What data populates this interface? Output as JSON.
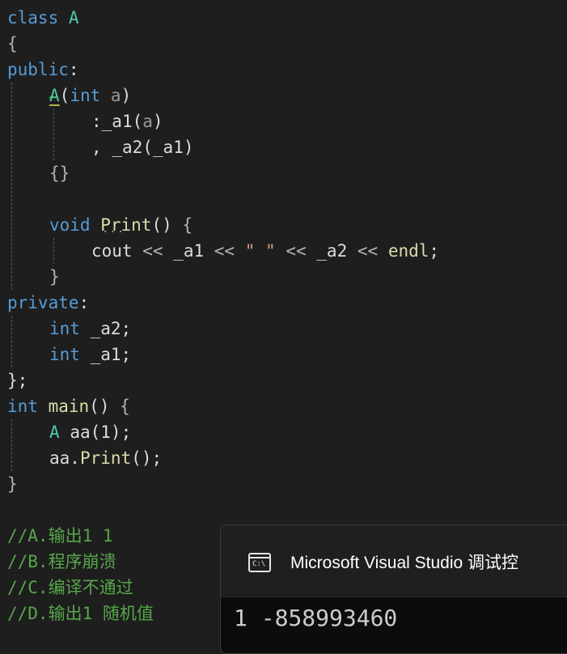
{
  "code": {
    "l1": {
      "kw": "class",
      "name": "A"
    },
    "l2": {
      "brace": "{"
    },
    "l3": {
      "kw": "public",
      "colon": ":"
    },
    "l4": {
      "ctor": "A",
      "lp": "(",
      "ty": "int",
      "param": "a",
      "rp": ")"
    },
    "l5": {
      "colon": ":",
      "m": "_a1",
      "lp": "(",
      "arg": "a",
      "rp": ")"
    },
    "l6": {
      "comma": ",",
      "m": "_a2",
      "lp": "(",
      "arg": "_a1",
      "rp": ")"
    },
    "l7": {
      "braces": "{}"
    },
    "l9": {
      "ty": "void",
      "fn": "Print",
      "parens": "()",
      "brace": "{"
    },
    "l10": {
      "cout": "cout",
      "op1": "<<",
      "a1": "_a1",
      "op2": "<<",
      "str": "\" \"",
      "op3": "<<",
      "a2": "_a2",
      "op4": "<<",
      "endl": "endl",
      "semi": ";"
    },
    "l11": {
      "brace": "}"
    },
    "l12": {
      "kw": "private",
      "colon": ":"
    },
    "l13": {
      "ty": "int",
      "name": "_a2",
      "semi": ";"
    },
    "l14": {
      "ty": "int",
      "name": "_a1",
      "semi": ";"
    },
    "l15": {
      "text": "};"
    },
    "l16": {
      "ty": "int",
      "fn": "main",
      "parens": "()",
      "brace": "{"
    },
    "l17": {
      "cls": "A",
      "var": "aa",
      "lp": "(",
      "num": "1",
      "rp": ")",
      "semi": ";"
    },
    "l18": {
      "obj": "aa",
      "dot": ".",
      "fn": "Print",
      "parens": "()",
      "semi": ";"
    },
    "l19": {
      "brace": "}"
    },
    "comments": [
      "//A.输出1 1",
      "//B.程序崩溃",
      "//C.编译不通过",
      "//D.输出1 随机值"
    ]
  },
  "console": {
    "icon": "console-app-icon",
    "icon_text": "C:\\",
    "title": "Microsoft Visual Studio 调试控",
    "output": "1 -858993460"
  },
  "colors": {
    "background": "#1e1e1e",
    "keyword": "#569cd6",
    "type": "#4ec9b0",
    "function": "#dcdcaa",
    "comment": "#57a64a"
  }
}
